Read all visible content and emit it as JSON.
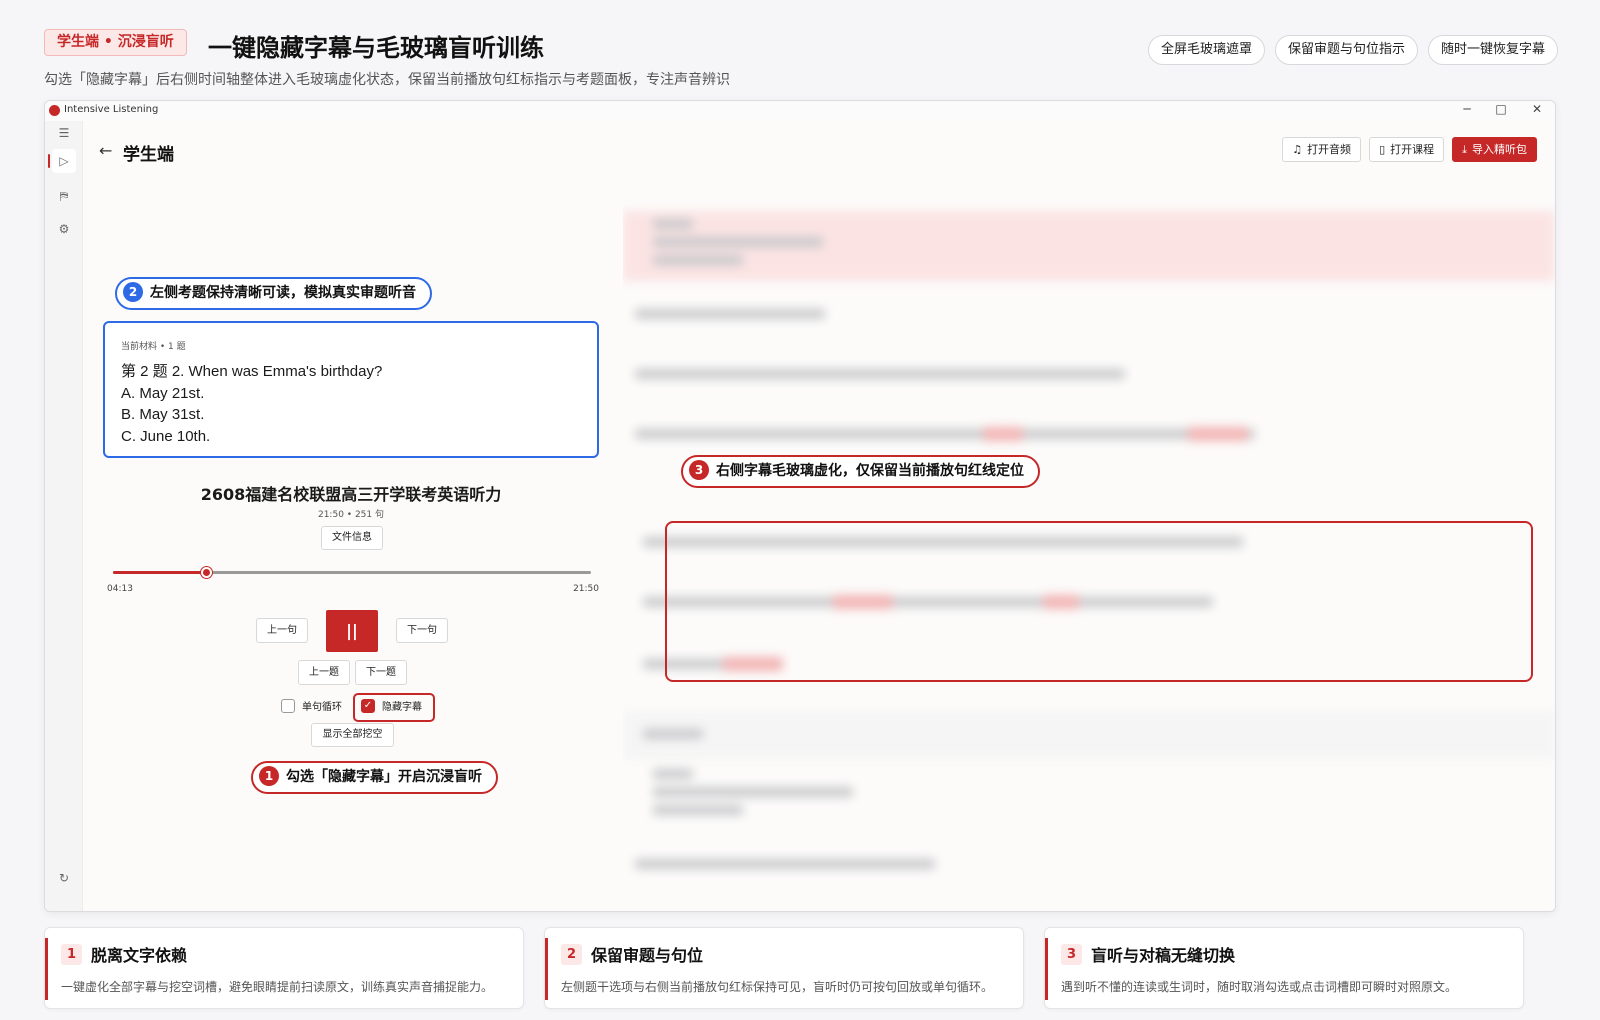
{
  "header": {
    "badge": "学生端 • 沉浸盲听",
    "title": "一键隐藏字幕与毛玻璃盲听训练",
    "subtitle": "勾选「隐藏字幕」后右侧时间轴整体进入毛玻璃虚化状态，保留当前播放句红标指示与考题面板，专注声音辨识",
    "tags": [
      "全屏毛玻璃遮罩",
      "保留审题与句位指示",
      "随时一键恢复字幕"
    ]
  },
  "window": {
    "title": "Intensive Listening",
    "controls": [
      "─",
      "□",
      "✕"
    ]
  },
  "app": {
    "page_title": "学生端",
    "toolbar": {
      "open_audio": "打开音频",
      "open_course": "打开课程",
      "import_pack": "导入精听包"
    }
  },
  "callouts": {
    "c1": {
      "num": "1",
      "text": "勾选「隐藏字幕」开启沉浸盲听"
    },
    "c2": {
      "num": "2",
      "text": "左侧考题保持清晰可读，模拟真实审题听音"
    },
    "c3": {
      "num": "3",
      "text": "右侧字幕毛玻璃虚化，仅保留当前播放句红线定位"
    }
  },
  "question": {
    "meta": "当前材料 • 1 题",
    "stem": "第 2 题  2. When was Emma's birthday?",
    "options": [
      "A. May 21st.",
      "B. May 31st.",
      "C. June 10th."
    ]
  },
  "material": {
    "title": "2608福建名校联盟高三开学联考英语听力",
    "meta": "21:50 • 251 句",
    "file_info": "文件信息"
  },
  "player": {
    "current": "04:13",
    "total": "21:50",
    "progress": 0.194,
    "prev_sentence": "上一句",
    "play_pause": "||",
    "next_sentence": "下一句",
    "prev_question": "上一题",
    "next_question": "下一题",
    "loop_label": "单句循环",
    "hide_subs_label": "隐藏字幕",
    "show_all": "显示全部挖空"
  },
  "features": [
    {
      "num": "1",
      "title": "脱离文字依赖",
      "desc": "一键虚化全部字幕与挖空词槽，避免眼睛提前扫读原文，训练真实声音捕捉能力。"
    },
    {
      "num": "2",
      "title": "保留审题与句位",
      "desc": "左侧题干选项与右侧当前播放句红标保持可见，盲听时仍可按句回放或单句循环。"
    },
    {
      "num": "3",
      "title": "盲听与对稿无缝切换",
      "desc": "遇到听不懂的连读或生词时，随时取消勾选或点击词槽即可瞬时对照原文。"
    }
  ],
  "colors": {
    "accent": "#c62828",
    "highlight_blue": "#2e6ae6"
  }
}
